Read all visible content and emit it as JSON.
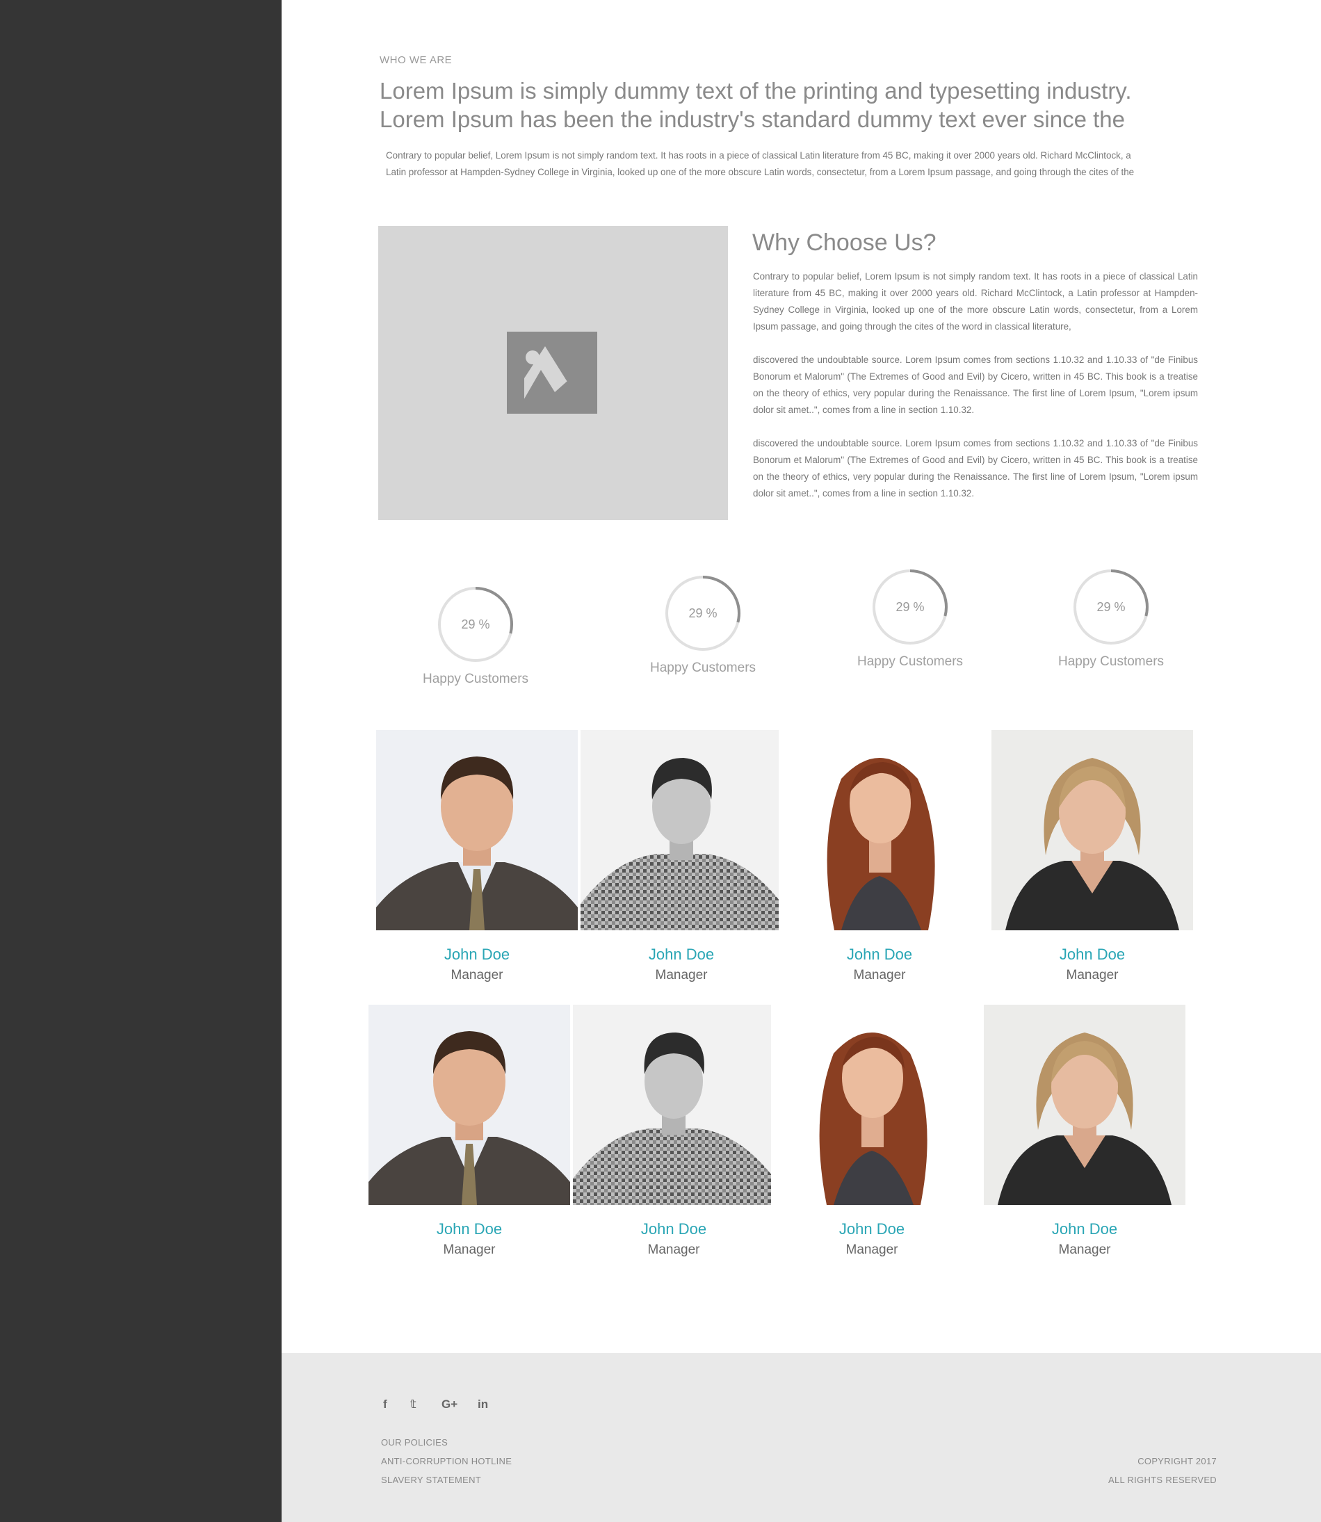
{
  "about": {
    "eyebrow": "WHO WE ARE",
    "headline_line1": "Lorem Ipsum is simply dummy text of the printing and typesetting industry.",
    "headline_line2": "Lorem Ipsum has been the industry's standard dummy text ever since the",
    "intro_line1": "Contrary to popular belief, Lorem Ipsum is not simply random text. It has roots in a piece of classical Latin literature from 45 BC, making it over 2000 years old. Richard McClintock, a",
    "intro_line2": "Latin professor at Hampden-Sydney College in Virginia, looked up one of the more obscure Latin words, consectetur, from a Lorem Ipsum passage, and going through the cites of the"
  },
  "why": {
    "title": "Why Choose Us?",
    "para1": "Contrary to popular belief, Lorem Ipsum is not simply random text. It has roots in a piece of classical Latin literature from 45 BC, making it over 2000 years old. Richard McClintock, a Latin professor at Hampden-Sydney College in Virginia, looked up one of the more obscure Latin words, consectetur, from a Lorem Ipsum passage, and going through the cites of the word in classical literature,",
    "para2": "discovered the undoubtable source. Lorem Ipsum comes from sections 1.10.32 and 1.10.33 of \"de Finibus Bonorum et Malorum\" (The Extremes of Good and Evil) by Cicero, written in 45 BC. This book is a treatise on the theory of ethics, very popular during the Renaissance. The first line of Lorem Ipsum, \"Lorem ipsum dolor sit amet..\", comes from a line in section 1.10.32.",
    "para3": "discovered the undoubtable source. Lorem Ipsum comes from sections 1.10.32 and 1.10.33 of \"de Finibus Bonorum et Malorum\" (The Extremes of Good and Evil) by Cicero, written in 45 BC. This book is a treatise on the theory of ethics, very popular during the Renaissance. The first line of Lorem Ipsum, \"Lorem ipsum dolor sit amet..\", comes from a line in section 1.10.32.",
    "image_icon": "image-placeholder-icon"
  },
  "stats": [
    {
      "value": "29 %",
      "percent": 29,
      "caption": "Happy Customers"
    },
    {
      "value": "29 %",
      "percent": 29,
      "caption": "Happy Customers"
    },
    {
      "value": "29 %",
      "percent": 29,
      "caption": "Happy Customers"
    },
    {
      "value": "29 %",
      "percent": 29,
      "caption": "Happy Customers"
    }
  ],
  "team": [
    {
      "name": "John Doe",
      "role": "Manager"
    },
    {
      "name": "John Doe",
      "role": "Manager"
    },
    {
      "name": "John Doe",
      "role": "Manager"
    },
    {
      "name": "John Doe",
      "role": "Manager"
    },
    {
      "name": "John Doe",
      "role": "Manager"
    },
    {
      "name": "John Doe",
      "role": "Manager"
    },
    {
      "name": "John Doe",
      "role": "Manager"
    },
    {
      "name": "John Doe",
      "role": "Manager"
    }
  ],
  "footer": {
    "social": [
      {
        "glyph": "f",
        "icon": "facebook-icon"
      },
      {
        "glyph": "𝕥",
        "icon": "twitter-icon"
      },
      {
        "glyph": "G+",
        "icon": "google-plus-icon"
      },
      {
        "glyph": "in",
        "icon": "linkedin-icon"
      }
    ],
    "links": [
      "OUR POLICIES",
      "ANTI-CORRUPTION HOTLINE",
      "SLAVERY STATEMENT"
    ],
    "copyright": "COPYRIGHT 2017",
    "rights": "ALL RIGHTS RESERVED"
  },
  "colors": {
    "sidebar": "#353535",
    "accent": "#2aa6b5",
    "footer_bg": "#e9e9e9",
    "placeholder_bg": "#d6d6d6"
  }
}
